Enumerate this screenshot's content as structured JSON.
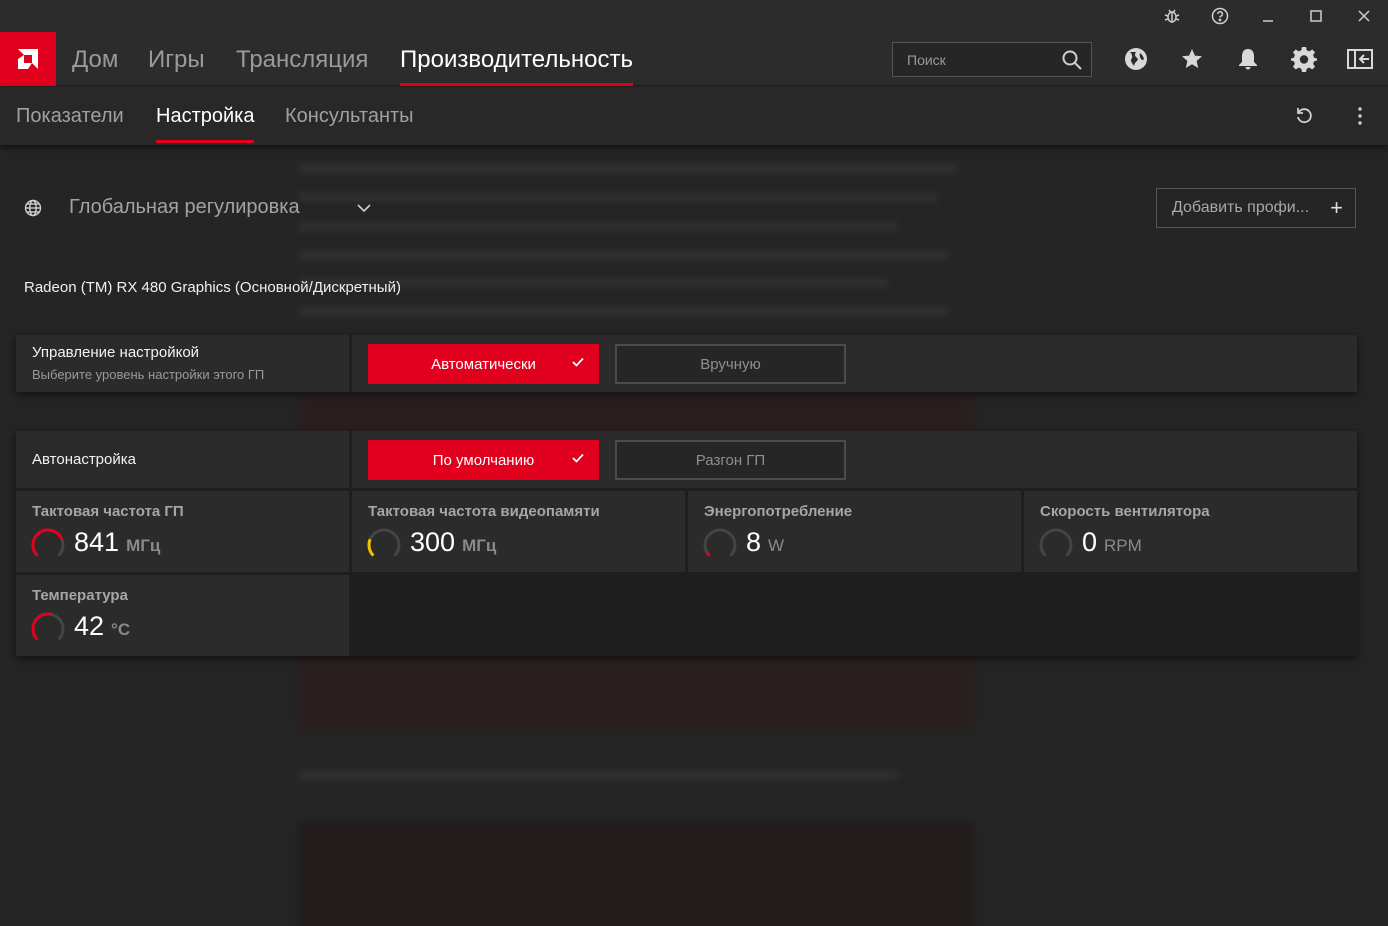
{
  "titlebar": {
    "icons": [
      "bug-icon",
      "help-icon",
      "minimize-icon",
      "maximize-icon",
      "close-icon"
    ]
  },
  "nav": {
    "logo": "amd-logo-icon",
    "items": [
      {
        "label": "Дом"
      },
      {
        "label": "Игры"
      },
      {
        "label": "Трансляция"
      },
      {
        "label": "Производительность",
        "active": true
      }
    ],
    "search_placeholder": "Поиск",
    "icons": [
      "globe-icon",
      "star-icon",
      "bell-icon",
      "gear-icon",
      "sidebar-icon"
    ]
  },
  "subnav": {
    "items": [
      {
        "label": "Показатели"
      },
      {
        "label": "Настройка",
        "active": true
      },
      {
        "label": "Консультанты"
      }
    ],
    "icons": [
      "reset-icon",
      "more-icon"
    ]
  },
  "profile": {
    "label": "Глобальная регулировка",
    "add_label": "Добавить профи...",
    "add_symbol": "+"
  },
  "gpu_name": "Radeon (TM) RX 480 Graphics (Основной/Дискретный)",
  "tuning_control": {
    "title": "Управление настройкой",
    "subtitle": "Выберите уровень настройки этого ГП",
    "options": [
      "Автоматически",
      "Вручную"
    ],
    "selected": "Автоматически"
  },
  "auto_tuning": {
    "title": "Автонастройка",
    "options": [
      "По умолчанию",
      "Разгон ГП"
    ],
    "selected": "По умолчанию"
  },
  "metrics": [
    {
      "label": "Тактовая частота ГП",
      "value": "841",
      "unit": "МГц",
      "level": 0.75,
      "color": "#e1001e"
    },
    {
      "label": "Тактовая частота видеопамяти",
      "value": "300",
      "unit": "МГц",
      "level": 0.25,
      "color": "#f0c000"
    },
    {
      "label": "Энергопотребление",
      "value": "8",
      "unit": "W",
      "level": 0.05,
      "color": "#e1001e"
    },
    {
      "label": "Скорость вентилятора",
      "value": "0",
      "unit": "RPM",
      "level": 0.0,
      "color": "#e1001e"
    },
    {
      "label": "Температура",
      "value": "42",
      "unit": "°C",
      "level": 0.55,
      "color": "#e1001e"
    }
  ],
  "colors": {
    "accent": "#e1001e",
    "background": "#252525",
    "panel": "#2b2b2b"
  }
}
